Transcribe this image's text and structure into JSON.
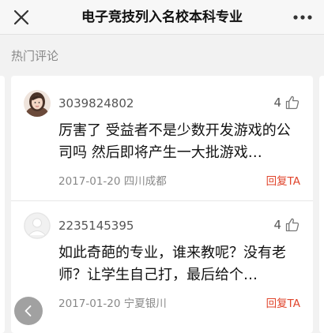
{
  "header": {
    "title": "电子竞技列入名校本科专业",
    "close_icon": "close-icon",
    "more_icon": "more-dots-icon"
  },
  "section": {
    "label": "热门评论"
  },
  "comments": [
    {
      "username": "3039824802",
      "likes": "4",
      "text": "厉害了 受益者不是少数开发游戏的公司吗 然后即将产生一大批游戏…",
      "date": "2017-01-20",
      "location": "四川成都",
      "reply_label": "回复TA",
      "avatar": "user-photo-avatar"
    },
    {
      "username": "2235145395",
      "likes": "4",
      "text": "如此奇葩的专业，谁来教呢？没有老师？让学生自己打，最后给个…",
      "date": "2017-01-20",
      "location": "宁夏银川",
      "reply_label": "回复TA",
      "avatar": "default-user-avatar"
    }
  ],
  "colors": {
    "accent_reply": "#e0452c",
    "background": "#f2f2f2"
  }
}
